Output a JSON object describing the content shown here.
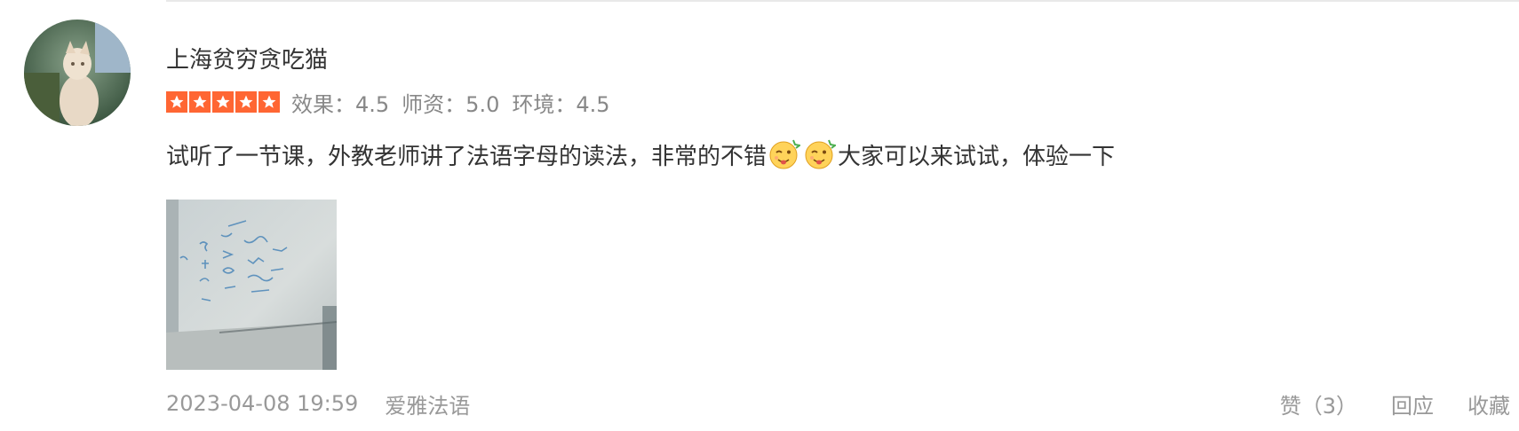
{
  "review": {
    "username": "上海贫穷贪吃猫",
    "rating": {
      "stars": 5,
      "star_color": "#ff6633",
      "scores": [
        {
          "label": "效果：4.5"
        },
        {
          "label": "师资：5.0"
        },
        {
          "label": "环境：4.5"
        }
      ]
    },
    "comment": {
      "part1": "试听了一节课，外教老师讲了法语字母的读法，非常的不错",
      "emoji": "tongue-wink-emoji",
      "part2": "大家可以来试试，体验一下"
    },
    "photo": {
      "icon": "whiteboard-photo"
    },
    "timestamp": "2023-04-08 19:59",
    "source": "爱雅法语",
    "actions": {
      "like_label": "赞（3）",
      "reply_label": "回应",
      "favorite_label": "收藏"
    }
  }
}
